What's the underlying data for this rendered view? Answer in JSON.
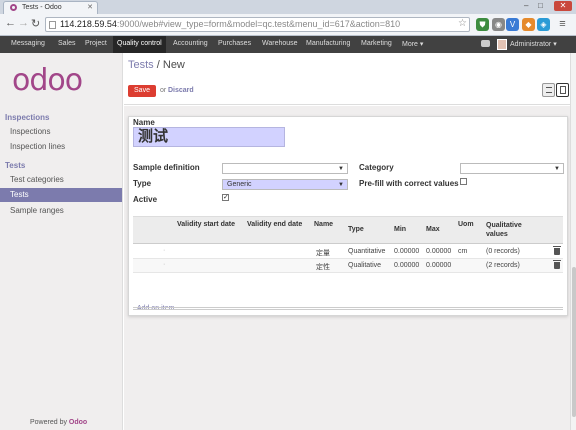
{
  "browser": {
    "tab_title": "Tests - Odoo",
    "url_host": "114.218.59.54",
    "url_path": ":9000/web#view_type=form&model=qc.test&menu_id=617&action=810"
  },
  "topbar": {
    "menu": [
      "Messaging",
      "Sales",
      "Project",
      "Quality control",
      "Accounting",
      "Purchases",
      "Warehouse",
      "Manufacturing",
      "Marketing",
      "More"
    ],
    "active_menu": "Quality control",
    "user": "Administrator"
  },
  "sidebar": {
    "logo": "odoo",
    "sections": [
      {
        "title": "Inspections",
        "items": [
          "Inspections",
          "Inspection lines"
        ]
      },
      {
        "title": "Tests",
        "items": [
          "Test categories",
          "Tests",
          "Sample ranges"
        ]
      }
    ],
    "active_item": "Tests",
    "powered_by": "Powered by",
    "powered_brand": "Odoo"
  },
  "control_panel": {
    "breadcrumb_parent": "Tests",
    "breadcrumb_sep": "/",
    "breadcrumb_current": "New",
    "save_label": "Save",
    "or_label": "or",
    "discard_label": "Discard"
  },
  "form": {
    "name_label": "Name",
    "name_value": "测试",
    "sample_definition_label": "Sample definition",
    "sample_definition_value": "",
    "type_label": "Type",
    "type_value": "Generic",
    "active_label": "Active",
    "active_checked": true,
    "category_label": "Category",
    "category_value": "",
    "prefill_label": "Pre-fill with correct values",
    "prefill_checked": false
  },
  "questions_table": {
    "headers": [
      "Validity start date",
      "Validity end date",
      "Name",
      "Type",
      "Min",
      "Max",
      "Uom",
      "Qualitative values"
    ],
    "rows": [
      {
        "name": "定量",
        "type": "Quantitative",
        "min": "0.00000",
        "max": "0.00000",
        "uom": "cm",
        "qualitative": "(0 records)"
      },
      {
        "name": "定性",
        "type": "Qualitative",
        "min": "0.00000",
        "max": "0.00000",
        "uom": "",
        "qualitative": "(2 records)"
      }
    ],
    "add_item_label": "Add an item"
  },
  "colors": {
    "brand": "#a24689",
    "accent": "#7c7bad",
    "save": "#dc3d31",
    "topbar": "#414141",
    "required_field": "#d2d2ff"
  }
}
